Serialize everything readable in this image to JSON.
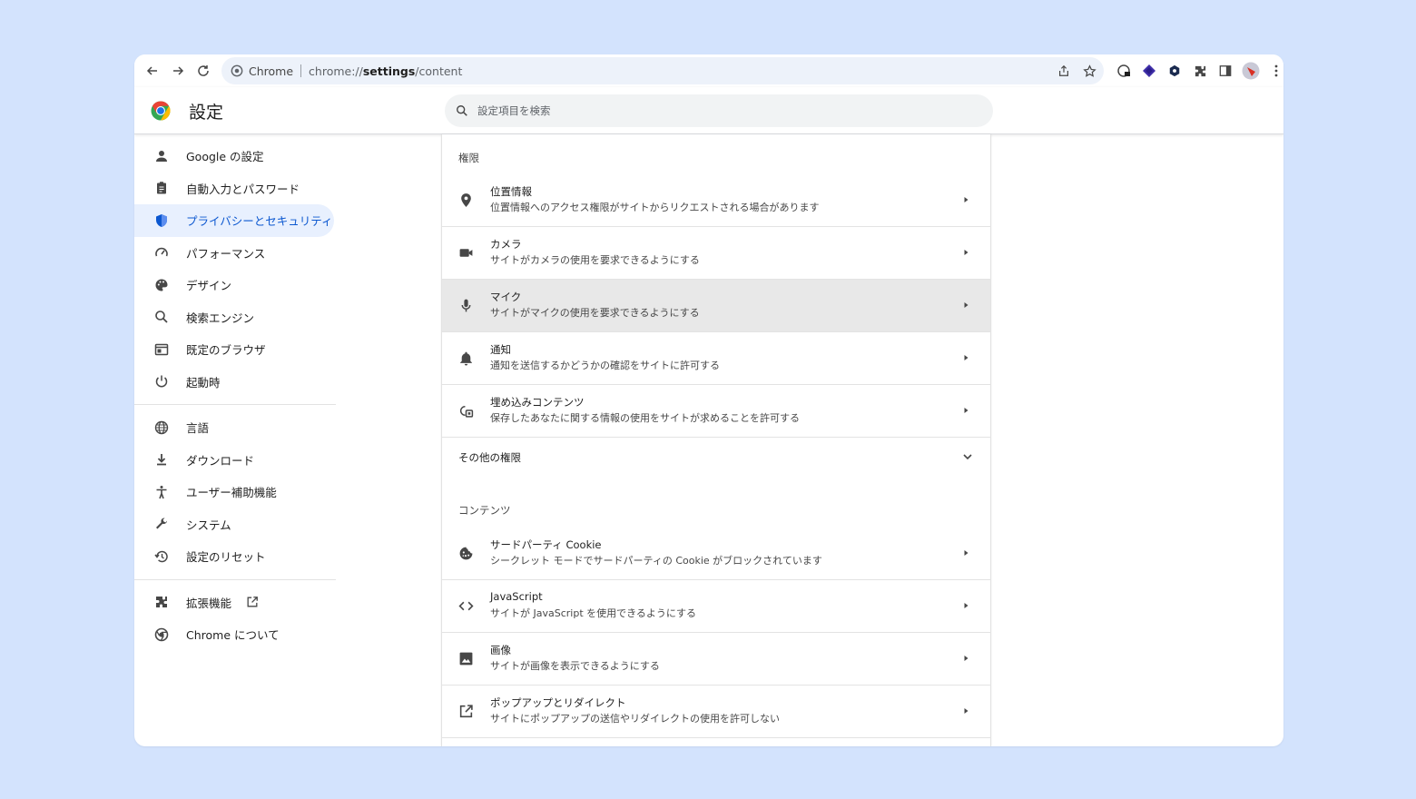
{
  "browser": {
    "chip_label": "Chrome",
    "url_scheme": "chrome://",
    "url_host": "settings",
    "url_path": "/content"
  },
  "header": {
    "title": "設定",
    "search_placeholder": "設定項目を検索"
  },
  "sidebar": {
    "items": [
      {
        "label": "Google の設定",
        "icon": "person-icon"
      },
      {
        "label": "自動入力とパスワード",
        "icon": "clipboard-icon"
      },
      {
        "label": "プライバシーとセキュリティ",
        "icon": "shield-icon"
      },
      {
        "label": "パフォーマンス",
        "icon": "speedometer-icon"
      },
      {
        "label": "デザイン",
        "icon": "palette-icon"
      },
      {
        "label": "検索エンジン",
        "icon": "search-icon"
      },
      {
        "label": "既定のブラウザ",
        "icon": "browser-icon"
      },
      {
        "label": "起動時",
        "icon": "power-icon"
      },
      {
        "label": "言語",
        "icon": "globe-icon"
      },
      {
        "label": "ダウンロード",
        "icon": "download-icon"
      },
      {
        "label": "ユーザー補助機能",
        "icon": "accessibility-icon"
      },
      {
        "label": "システム",
        "icon": "wrench-icon"
      },
      {
        "label": "設定のリセット",
        "icon": "history-icon"
      },
      {
        "label": "拡張機能",
        "icon": "puzzle-icon"
      },
      {
        "label": "Chrome について",
        "icon": "chrome-icon"
      }
    ]
  },
  "main": {
    "permissions_label": "権限",
    "permissions": [
      {
        "title": "位置情報",
        "desc": "位置情報へのアクセス権限がサイトからリクエストされる場合があります",
        "icon": "location-pin-icon"
      },
      {
        "title": "カメラ",
        "desc": "サイトがカメラの使用を要求できるようにする",
        "icon": "camera-icon"
      },
      {
        "title": "マイク",
        "desc": "サイトがマイクの使用を要求できるようにする",
        "icon": "microphone-icon"
      },
      {
        "title": "通知",
        "desc": "通知を送信するかどうかの確認をサイトに許可する",
        "icon": "bell-icon"
      },
      {
        "title": "埋め込みコンテンツ",
        "desc": "保存したあなたに関する情報の使用をサイトが求めることを許可する",
        "icon": "embedded-content-icon"
      }
    ],
    "more_permissions_label": "その他の権限",
    "content_label": "コンテンツ",
    "content": [
      {
        "title": "サードパーティ Cookie",
        "desc": "シークレット モードでサードパーティの Cookie がブロックされています",
        "icon": "cookie-icon"
      },
      {
        "title": "JavaScript",
        "desc": "サイトが JavaScript を使用できるようにする",
        "icon": "code-icon"
      },
      {
        "title": "画像",
        "desc": "サイトが画像を表示できるようにする",
        "icon": "image-icon"
      },
      {
        "title": "ポップアップとリダイレクト",
        "desc": "サイトにポップアップの送信やリダイレクトの使用を許可しない",
        "icon": "open-in-new-icon"
      }
    ]
  },
  "colors": {
    "page_bg": "#d3e3fd",
    "accent": "#0b57d0",
    "active_bg": "#e8f0fe",
    "hover_row": "#e8e8e8"
  }
}
